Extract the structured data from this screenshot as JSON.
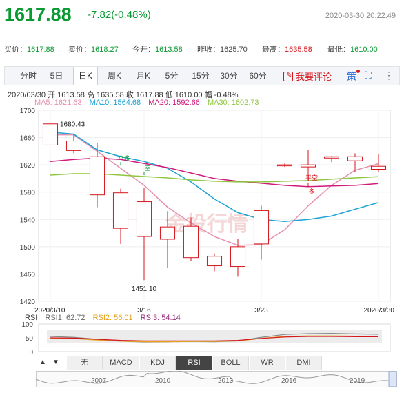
{
  "header": {
    "price": "1617.88",
    "change": "-7.82(-0.48%)",
    "timestamp": "2020-03-30 20:22:49"
  },
  "quote": {
    "bid_label": "买价：",
    "bid": "1617.88",
    "ask_label": "卖价：",
    "ask": "1618.27",
    "open_label": "今开：",
    "open": "1613.58",
    "prev_label": "昨收：",
    "prev": "1625.70",
    "high_label": "最高：",
    "high": "1635.58",
    "low_label": "最低：",
    "low": "1610.00"
  },
  "tabs": [
    "分时",
    "5日",
    "日K",
    "周K",
    "月K",
    "5分",
    "15分",
    "30分",
    "60分"
  ],
  "active_tab": "日K",
  "comment_button": "我要评论",
  "info_line": "2020/03/30  开 1613.58  高 1635.58  收 1617.88  低 1610.00  幅 -0.48%",
  "ma_legend": [
    {
      "label": "MA5: 1621.63",
      "color": "#e58fb0"
    },
    {
      "label": "MA10: 1564.68",
      "color": "#1aa3d6"
    },
    {
      "label": "MA20: 1592.66",
      "color": "#d0197a"
    },
    {
      "label": "MA30: 1602.73",
      "color": "#8fc640"
    }
  ],
  "rsi_legend": [
    {
      "label": "RSI",
      "color": "#333"
    },
    {
      "label": "RSI1: 62.72",
      "color": "#666"
    },
    {
      "label": "RSI2: 56.01",
      "color": "#e8a11c"
    },
    {
      "label": "RSI3: 54.14",
      "color": "#9a2a7a"
    }
  ],
  "indicator_tabs": [
    "无",
    "MACD",
    "KDJ",
    "RSI",
    "BOLL",
    "WR",
    "DMI"
  ],
  "active_indicator": "RSI",
  "nav_years": [
    "2007",
    "2010",
    "2013",
    "2016",
    "2019"
  ],
  "watermark": "金投行情",
  "chart_data": {
    "type": "candlestick",
    "ylim": [
      1420,
      1700
    ],
    "yticks": [
      1700,
      1660,
      1620,
      1580,
      1540,
      1500,
      1460,
      1420
    ],
    "x_labels": [
      "2020/3/10",
      "3/16",
      "3/23",
      "2020/3/30"
    ],
    "candles": [
      {
        "date": "2020/3/10",
        "open": 1649,
        "close": 1680,
        "high": 1680,
        "low": 1649
      },
      {
        "date": "2020/3/11",
        "open": 1641,
        "close": 1655,
        "high": 1664,
        "low": 1637
      },
      {
        "date": "2020/3/12",
        "open": 1576,
        "close": 1632,
        "high": 1652,
        "low": 1558
      },
      {
        "date": "2020/3/13",
        "open": 1527,
        "close": 1579,
        "high": 1585,
        "low": 1504
      },
      {
        "date": "2020/3/16",
        "open": 1515,
        "close": 1566,
        "high": 1586,
        "low": 1451.1
      },
      {
        "date": "2020/3/17",
        "open": 1511,
        "close": 1529,
        "high": 1552,
        "low": 1469
      },
      {
        "date": "2020/3/18",
        "open": 1484,
        "close": 1530,
        "high": 1543,
        "low": 1479
      },
      {
        "date": "2020/3/19",
        "open": 1472,
        "close": 1486,
        "high": 1490,
        "low": 1464
      },
      {
        "date": "2020/3/20",
        "open": 1471,
        "close": 1500,
        "high": 1512,
        "low": 1456
      },
      {
        "date": "2020/3/23",
        "open": 1504,
        "close": 1553,
        "high": 1560,
        "low": 1481
      },
      {
        "date": "2020/3/24",
        "open": 1619,
        "close": 1620,
        "high": 1622,
        "low": 1617
      },
      {
        "date": "2020/3/25",
        "open": 1617,
        "close": 1620,
        "high": 1642,
        "low": 1597
      },
      {
        "date": "2020/3/26",
        "open": 1630,
        "close": 1632,
        "high": 1633,
        "low": 1624
      },
      {
        "date": "2020/3/27",
        "open": 1626,
        "close": 1632,
        "high": 1637,
        "low": 1609
      },
      {
        "date": "2020/3/30",
        "open": 1613.58,
        "close": 1617.88,
        "high": 1635.58,
        "low": 1610
      }
    ],
    "series": [
      {
        "name": "MA5",
        "color": "#e58fb0",
        "values": [
          1664,
          1664,
          1640,
          1615,
          1590,
          1558,
          1535,
          1515,
          1502,
          1503,
          1525,
          1560,
          1590,
          1612,
          1621.63
        ]
      },
      {
        "name": "MA10",
        "color": "#1aa3d6",
        "values": [
          1668,
          1665,
          1642,
          1632,
          1625,
          1615,
          1595,
          1570,
          1550,
          1540,
          1537,
          1540,
          1545,
          1555,
          1564.68
        ]
      },
      {
        "name": "MA20",
        "color": "#d0197a",
        "values": [
          1625,
          1628,
          1630,
          1628,
          1622,
          1616,
          1608,
          1600,
          1596,
          1593,
          1590,
          1588,
          1589,
          1590,
          1592.66
        ]
      },
      {
        "name": "MA30",
        "color": "#8fc640",
        "values": [
          1605,
          1607,
          1607,
          1605,
          1603,
          1601,
          1598,
          1596,
          1595,
          1595,
          1596,
          1597,
          1599,
          1601,
          1602.73
        ]
      }
    ],
    "annotations": [
      {
        "text": "1680.43",
        "date": "2020/3/10"
      },
      {
        "text": "1451.10",
        "date": "2020/3/16"
      },
      {
        "text": "平多",
        "date": "2020/3/13"
      },
      {
        "text": "空",
        "date": "2020/3/16"
      },
      {
        "text": "平空",
        "date": "2020/3/25"
      },
      {
        "text": "多",
        "date": "2020/3/25"
      }
    ],
    "rsi": {
      "ylim": [
        0,
        100
      ],
      "yticks": [
        100,
        50,
        0
      ],
      "series": [
        {
          "name": "RSI1",
          "color": "#888",
          "values": [
            55,
            52,
            45,
            38,
            35,
            36,
            37,
            36,
            39,
            52,
            62,
            65,
            66,
            64,
            62.72
          ]
        },
        {
          "name": "RSI2",
          "color": "#e8a11c",
          "values": [
            48,
            47,
            42,
            38,
            36,
            36,
            37,
            37,
            39,
            48,
            55,
            57,
            57,
            56,
            56.01
          ]
        },
        {
          "name": "RSI3",
          "color": "#d6161e",
          "values": [
            50,
            49,
            45,
            41,
            39,
            39,
            39,
            39,
            41,
            48,
            53,
            55,
            55,
            54,
            54.14
          ]
        }
      ]
    }
  }
}
